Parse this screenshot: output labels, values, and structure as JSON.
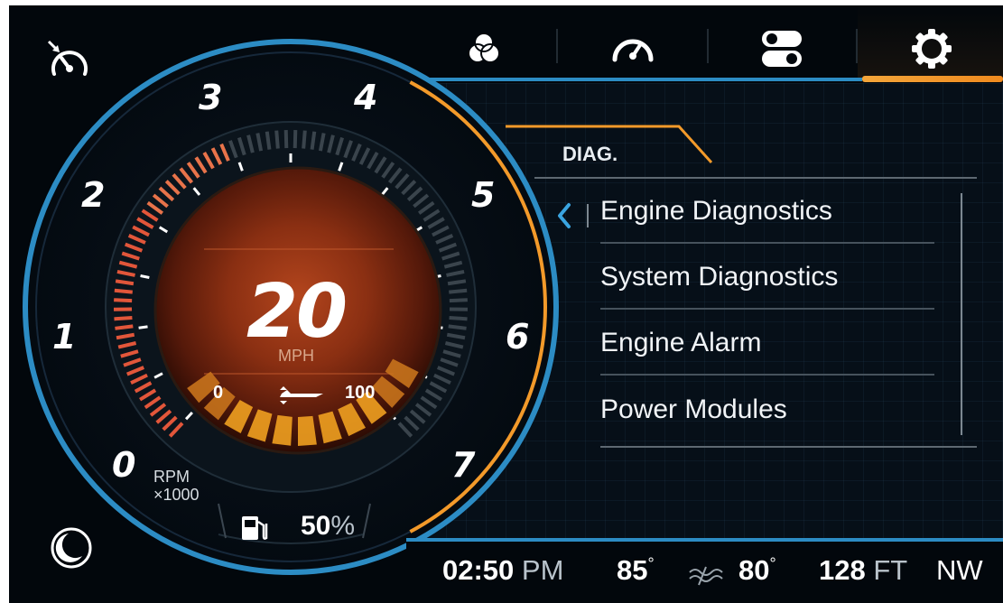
{
  "top_nav": {
    "icons": [
      {
        "name": "color-circles-icon",
        "active": false
      },
      {
        "name": "speedometer-icon",
        "active": false
      },
      {
        "name": "toggles-icon",
        "active": false
      },
      {
        "name": "gear-icon",
        "active": true
      }
    ]
  },
  "left_icons": {
    "top": "speed-timer-icon",
    "bottom": "moon-icon"
  },
  "gauge": {
    "rpm_numbers": [
      "0",
      "1",
      "2",
      "3",
      "4",
      "5",
      "6",
      "7"
    ],
    "rpm_unit_line1": "RPM",
    "rpm_unit_line2": "×1000",
    "speed": "20",
    "speed_unit": "MPH",
    "trim_min": "0",
    "trim_max": "100",
    "fuel_value": "50",
    "fuel_unit": "%"
  },
  "panel": {
    "tab_label": "DIAG.",
    "menu_items": [
      {
        "label": "Engine Diagnostics"
      },
      {
        "label": "System Diagnostics"
      },
      {
        "label": "Engine Alarm"
      },
      {
        "label": "Power Modules"
      }
    ]
  },
  "status_bar": {
    "time": "02:50",
    "ampm": "PM",
    "air_temp": "85",
    "water_temp": "80",
    "degree": "°",
    "depth": "128",
    "depth_unit": "FT",
    "heading": "NW"
  },
  "colors": {
    "accent_blue": "#2c8cc4",
    "accent_orange": "#f39a2a",
    "rpm_red": "#e2563a",
    "background": "#02070c"
  }
}
